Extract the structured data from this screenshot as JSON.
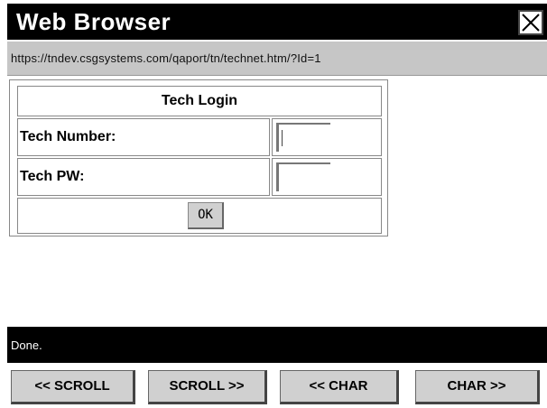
{
  "window": {
    "title": "Web Browser",
    "close_icon": "close-icon"
  },
  "address": {
    "url": "https://tndev.csgsystems.com/qaport/tn/technet.htm/?Id=1"
  },
  "form": {
    "title": "Tech Login",
    "tech_number_label": "Tech Number:",
    "tech_number_value": "",
    "tech_pw_label": "Tech PW:",
    "tech_pw_value": "",
    "ok_label": "OK"
  },
  "status": {
    "text": "Done."
  },
  "toolbar": {
    "scroll_left": "<< SCROLL",
    "scroll_right": "SCROLL >>",
    "char_left": "<< CHAR",
    "char_right": "CHAR >>"
  }
}
